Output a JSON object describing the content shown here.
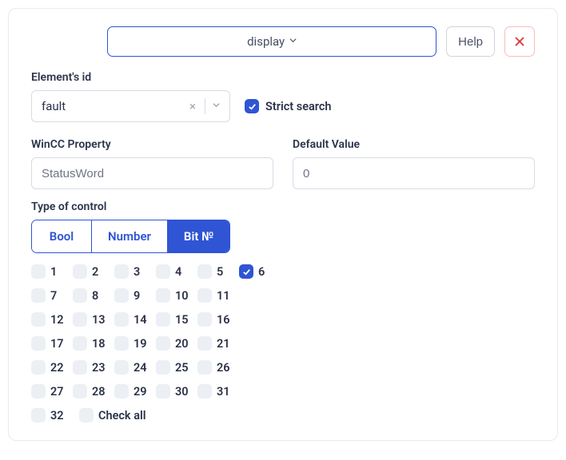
{
  "topbar": {
    "dropdown_label": "display",
    "help_label": "Help"
  },
  "element_id": {
    "label": "Element's id",
    "value": "fault"
  },
  "strict_search": {
    "label": "Strict search",
    "checked": true
  },
  "wincc": {
    "label": "WinCC Property",
    "value": "StatusWord"
  },
  "default_value": {
    "label": "Default Value",
    "value": "0"
  },
  "type_of_control": {
    "label": "Type of control",
    "options": {
      "bool": "Bool",
      "number": "Number",
      "bit_no": "Bit №"
    },
    "active": "bit_no"
  },
  "bits": {
    "items": [
      {
        "n": "1",
        "checked": false
      },
      {
        "n": "2",
        "checked": false
      },
      {
        "n": "3",
        "checked": false
      },
      {
        "n": "4",
        "checked": false
      },
      {
        "n": "5",
        "checked": false
      },
      {
        "n": "6",
        "checked": true
      },
      {
        "n": "7",
        "checked": false
      },
      {
        "n": "8",
        "checked": false
      },
      {
        "n": "9",
        "checked": false
      },
      {
        "n": "10",
        "checked": false
      },
      {
        "n": "11",
        "checked": false
      },
      {
        "n": "12",
        "checked": false
      },
      {
        "n": "13",
        "checked": false
      },
      {
        "n": "14",
        "checked": false
      },
      {
        "n": "15",
        "checked": false
      },
      {
        "n": "16",
        "checked": false
      },
      {
        "n": "17",
        "checked": false
      },
      {
        "n": "18",
        "checked": false
      },
      {
        "n": "19",
        "checked": false
      },
      {
        "n": "20",
        "checked": false
      },
      {
        "n": "21",
        "checked": false
      },
      {
        "n": "22",
        "checked": false
      },
      {
        "n": "23",
        "checked": false
      },
      {
        "n": "24",
        "checked": false
      },
      {
        "n": "25",
        "checked": false
      },
      {
        "n": "26",
        "checked": false
      },
      {
        "n": "27",
        "checked": false
      },
      {
        "n": "28",
        "checked": false
      },
      {
        "n": "29",
        "checked": false
      },
      {
        "n": "30",
        "checked": false
      },
      {
        "n": "31",
        "checked": false
      }
    ],
    "last": {
      "n": "32",
      "checked": false
    },
    "check_all_label": "Check all",
    "check_all_checked": false
  }
}
